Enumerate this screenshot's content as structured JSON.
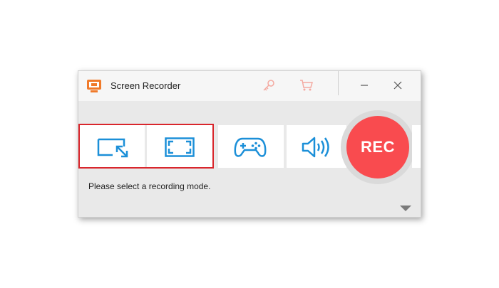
{
  "window": {
    "title": "Screen Recorder",
    "icons": {
      "app": "screen-recorder-icon",
      "register": "key-icon",
      "buy": "cart-icon",
      "minimize": "minimize-icon",
      "close": "close-icon"
    }
  },
  "modes": [
    {
      "name": "region",
      "icon": "region-select-icon"
    },
    {
      "name": "fullscreen",
      "icon": "fullscreen-icon"
    },
    {
      "name": "game",
      "icon": "gamepad-icon"
    },
    {
      "name": "audio",
      "icon": "speaker-icon"
    }
  ],
  "rec": {
    "label": "REC"
  },
  "status": {
    "hint": "Please select a recording mode."
  },
  "colors": {
    "accent": "#1b8fd8",
    "rec": "#f94b4f",
    "highlight": "#d9262c",
    "title_icon": "#f07a2a",
    "faded_icon": "#f4a9a0"
  }
}
